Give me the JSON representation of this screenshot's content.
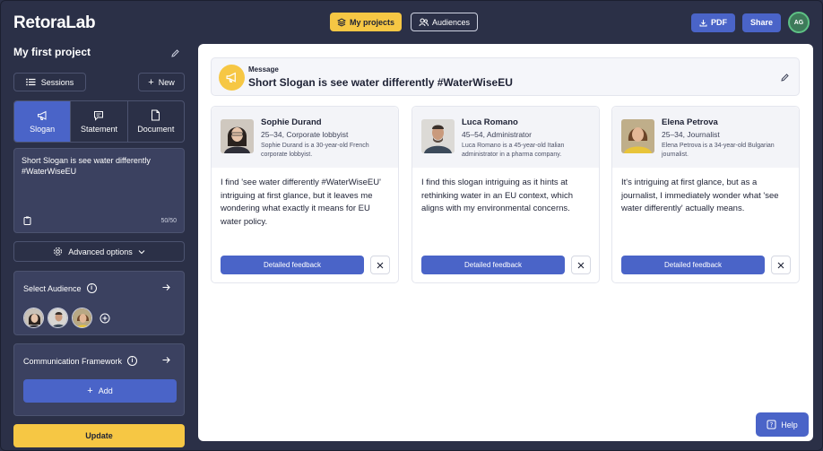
{
  "header": {
    "logo": "RetoraLab",
    "my_projects": "My projects",
    "audiences": "Audiences",
    "pdf": "PDF",
    "share": "Share",
    "avatar_initials": "AG"
  },
  "sidebar": {
    "project_title": "My first project",
    "sessions": "Sessions",
    "new": "New",
    "tabs": [
      {
        "label": "Slogan",
        "icon": "megaphone-icon",
        "active": true
      },
      {
        "label": "Statement",
        "icon": "chat-icon",
        "active": false
      },
      {
        "label": "Document",
        "icon": "document-icon",
        "active": false
      }
    ],
    "message_text": "Short Slogan is see water differently #WaterWiseEU",
    "char_count": "50/50",
    "advanced_options": "Advanced options",
    "select_audience": "Select Audience",
    "communication_framework": "Communication Framework",
    "add": "Add",
    "update": "Update"
  },
  "main": {
    "message_label": "Message",
    "message_text": "Short Slogan is see water differently #WaterWiseEU",
    "personas": [
      {
        "name": "Sophie Durand",
        "role": "25–34, Corporate lobbyist",
        "description": "Sophie Durand is a 30-year-old French corporate lobbyist.",
        "feedback": "I find 'see water differently #WaterWiseEU' intriguing at first glance, but it leaves me wondering what exactly it means for EU water policy.",
        "button": "Detailed feedback"
      },
      {
        "name": "Luca Romano",
        "role": "45–54, Administrator",
        "description": "Luca Romano is a 45-year-old Italian administrator in a pharma company.",
        "feedback": "I find this slogan intriguing as it hints at rethinking water in an EU context, which aligns with my environmental concerns.",
        "button": "Detailed feedback"
      },
      {
        "name": "Elena Petrova",
        "role": "25–34, Journalist",
        "description": "Elena Petrova is a 34-year-old Bulgarian journalist.",
        "feedback": "It's intriguing at first glance, but as a journalist, I immediately wonder what 'see water differently' actually means.",
        "button": "Detailed feedback"
      }
    ]
  },
  "help": "Help",
  "colors": {
    "background": "#2b3047",
    "panel": "#3b4160",
    "accent_blue": "#4a64c8",
    "accent_yellow": "#f6c744"
  }
}
